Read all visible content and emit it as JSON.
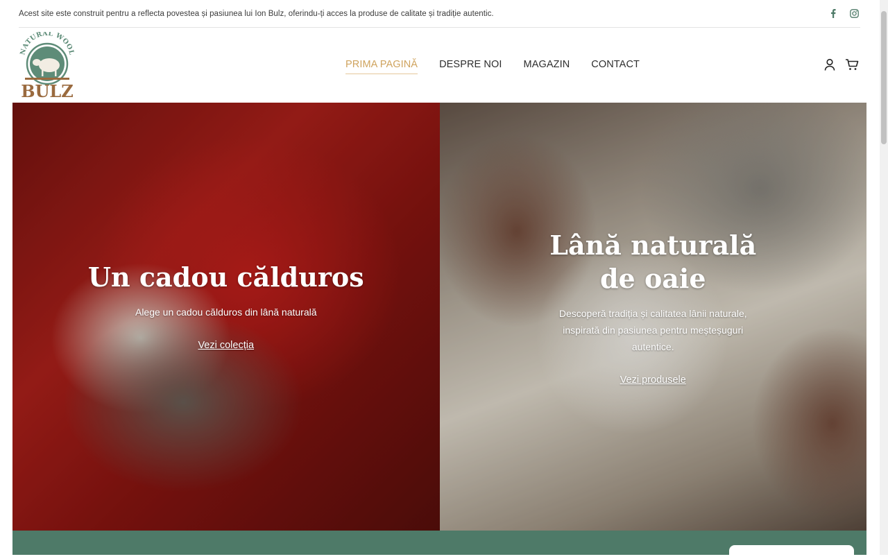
{
  "topbar": {
    "text": "Acest site este construit pentru a reflecta povestea și pasiunea lui Ion Bulz, oferindu-ți acces la produse de calitate și tradiție autentic.",
    "social_icons": [
      "facebook-icon",
      "instagram-icon"
    ]
  },
  "header": {
    "logo": {
      "line1": "NATURAL WOOL",
      "line2": "BULZ"
    },
    "nav": [
      {
        "label": "PRIMA PAGINĂ",
        "active": true
      },
      {
        "label": "DESPRE NOI",
        "active": false
      },
      {
        "label": "MAGAZIN",
        "active": false
      },
      {
        "label": "CONTACT",
        "active": false
      }
    ],
    "icons": [
      "account-icon",
      "cart-icon"
    ]
  },
  "hero": {
    "left": {
      "title": "Un cadou călduros",
      "description": "Alege un cadou călduros din lână naturală",
      "link": "Vezi colecția"
    },
    "right": {
      "title": "Lână naturală de oaie",
      "description": "Descoperă tradiția și calitatea lânii naturale, inspirată din pasiunea pentru meșteșuguri autentice.",
      "link": "Vezi produsele"
    }
  },
  "colors": {
    "accent_active_nav": "#cfa35d",
    "band": "#4e7a68",
    "logo_green": "#5e8c78",
    "logo_brown": "#9a6a3e"
  }
}
